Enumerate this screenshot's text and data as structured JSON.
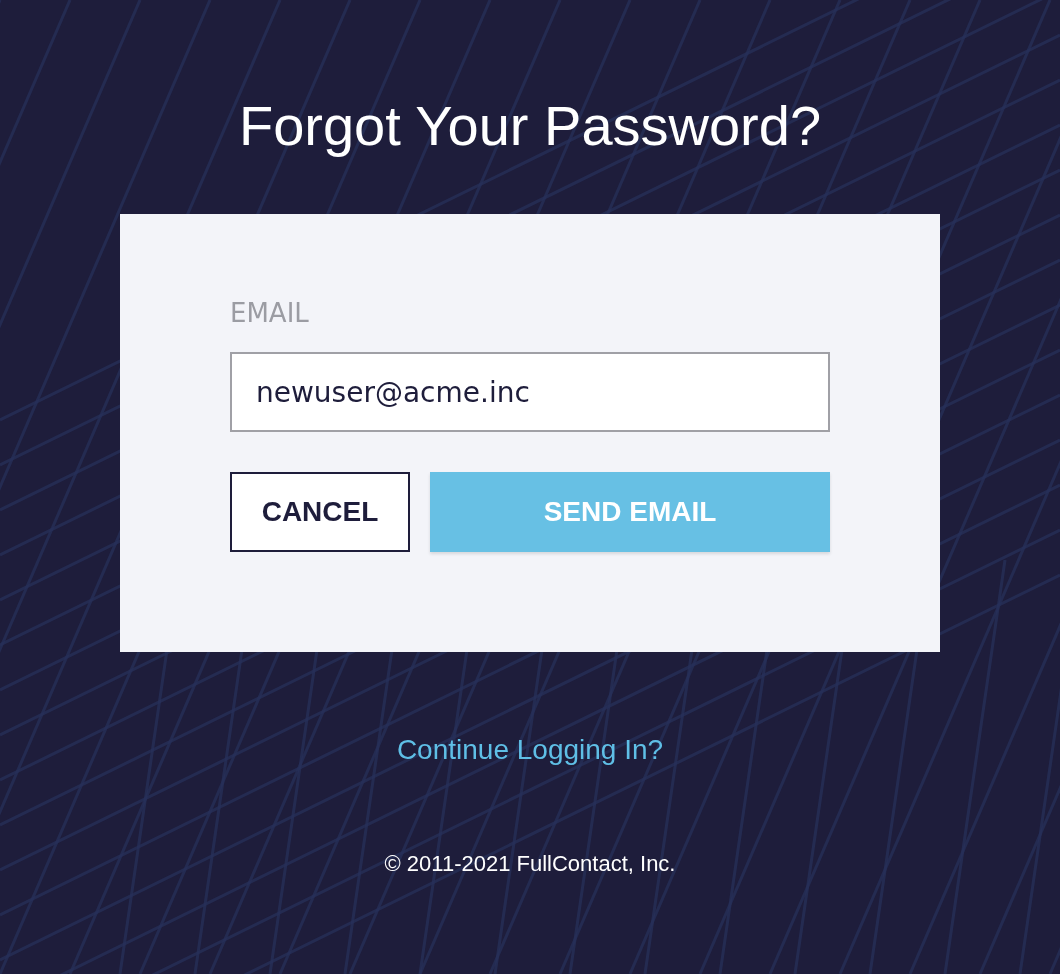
{
  "title": "Forgot Your Password?",
  "form": {
    "email_label": "EMAIL",
    "email": {
      "value": "newuser@acme.inc"
    },
    "buttons": [
      {
        "label": "CANCEL",
        "kind": "secondary"
      },
      {
        "label": "SEND EMAIL",
        "kind": "primary"
      }
    ]
  },
  "link": "Continue Logging In?",
  "footer": "© 2011-2021 FullContact, Inc."
}
